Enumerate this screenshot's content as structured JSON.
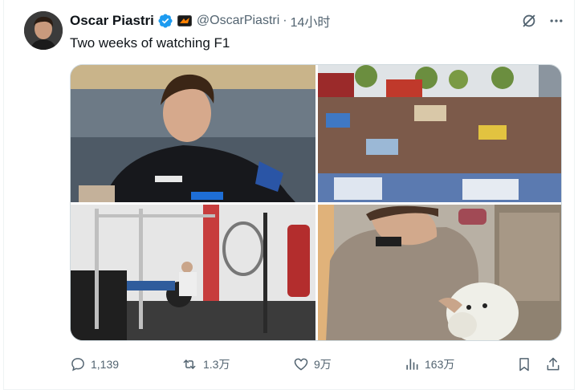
{
  "author": {
    "display_name": "Oscar Piastri",
    "handle": "@OscarPiastri",
    "separator": "·",
    "time_ago": "14小时",
    "verified": true
  },
  "tweet": {
    "text": "Two weeks of watching F1"
  },
  "media": [
    {
      "icon": "photo-driver-portrait"
    },
    {
      "icon": "photo-fan-crowd"
    },
    {
      "icon": "photo-gym"
    },
    {
      "icon": "photo-dog-petting"
    }
  ],
  "actions": {
    "replies": "1,139",
    "reposts": "1.3万",
    "likes": "9万",
    "views": "163万"
  },
  "colors": {
    "verified": "#1d9bf0",
    "text_primary": "#0f1419",
    "text_secondary": "#536471",
    "border": "#cfd9de"
  }
}
